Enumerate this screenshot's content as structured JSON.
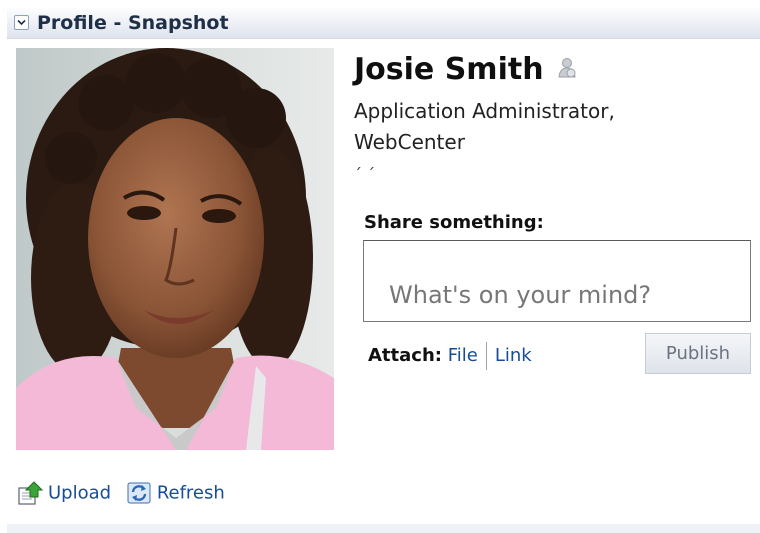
{
  "header": {
    "title": "Profile - Snapshot",
    "disclosure_icon": "chevron-down-icon"
  },
  "profile": {
    "name": "Josie Smith",
    "presence_icon": "presence-status-icon",
    "title": "Application Administrator, WebCenter",
    "status_text": "´ ´"
  },
  "share": {
    "label": "Share something:",
    "placeholder": "What's on your mind?",
    "value": "",
    "attach_label": "Attach:",
    "attach_file": "File",
    "attach_link": "Link",
    "publish_label": "Publish"
  },
  "toolbar": {
    "upload_label": "Upload",
    "upload_icon": "upload-icon",
    "refresh_label": "Refresh",
    "refresh_icon": "refresh-icon"
  },
  "colors": {
    "link": "#174c97",
    "header_bg": "#eceff5"
  }
}
